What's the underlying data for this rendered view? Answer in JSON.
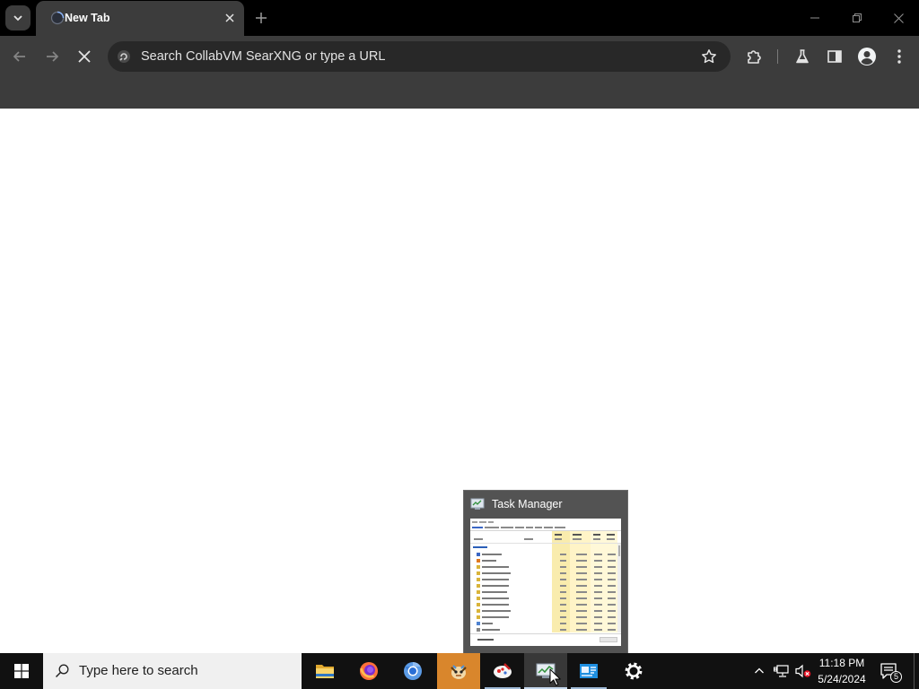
{
  "window": {
    "controls": [
      "minimize-icon",
      "restore-icon",
      "close-icon"
    ]
  },
  "browser": {
    "tab": {
      "title": "New Tab",
      "favicon": "loading-globe-icon"
    },
    "omnibox": {
      "placeholder": "Search CollabVM SearXNG or type a URL",
      "value": ""
    },
    "toolbar_icons": [
      "back-arrow-icon",
      "forward-arrow-icon",
      "stop-loading-icon",
      "bookmark-star-icon",
      "extensions-puzzle-icon",
      "labs-flask-icon",
      "side-panel-icon",
      "profile-avatar-icon",
      "more-menu-icon"
    ]
  },
  "task_manager_preview": {
    "title": "Task Manager"
  },
  "taskbar": {
    "search": {
      "placeholder": "Type here to search"
    },
    "pinned_apps": [
      "file-explorer-icon",
      "firefox-icon",
      "chromium-icon",
      "creature-app-icon",
      "paint-app-icon",
      "task-manager-icon",
      "system-info-icon",
      "settings-gear-icon"
    ],
    "clock": {
      "time": "11:18 PM",
      "date": "5/24/2024"
    },
    "notifications": {
      "count": "5"
    }
  },
  "colors": {
    "browser_frame": "#3c3c3c",
    "omnibox_bg": "#282828",
    "taskbar_bg": "#111111",
    "flashing_app": "#d9862c",
    "task_manager_highlight": "#fff4c7"
  }
}
